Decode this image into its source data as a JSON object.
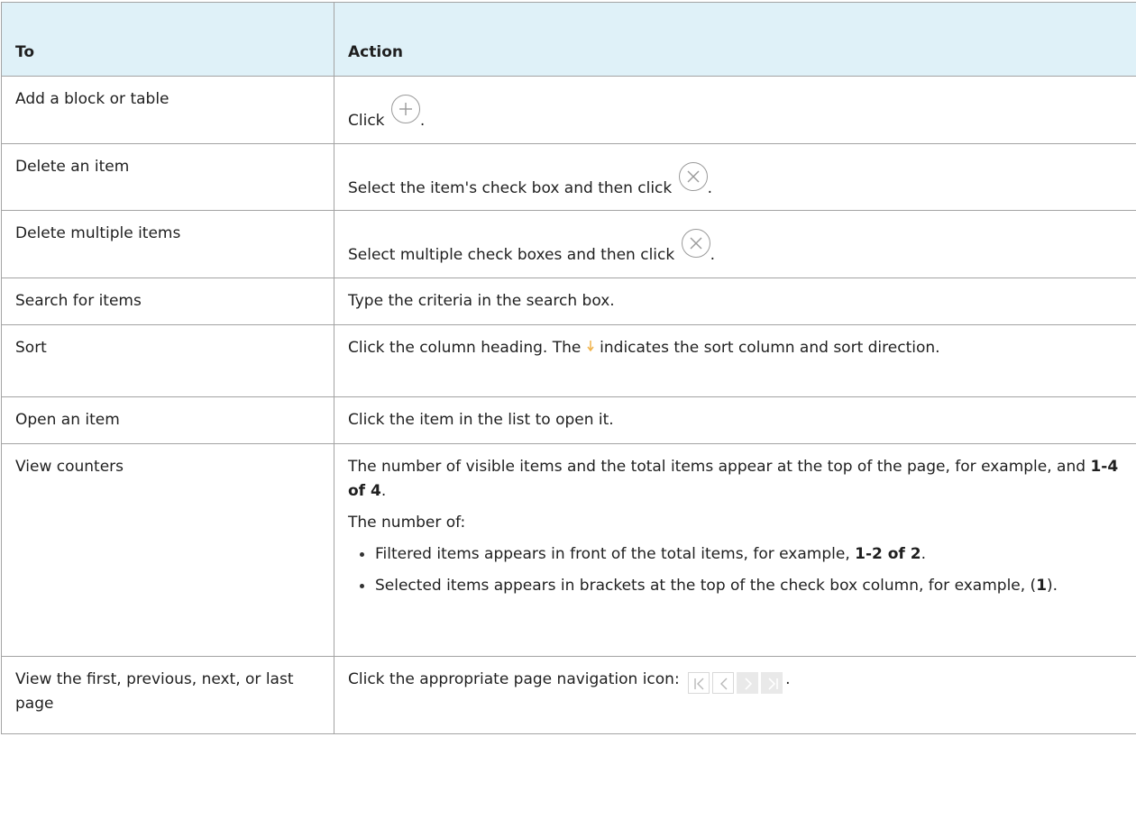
{
  "header": {
    "col_to": "To",
    "col_action": "Action"
  },
  "rows": [
    {
      "to": "Add a block or table",
      "action_pre": "Click",
      "action_post": "."
    },
    {
      "to": "Delete an item",
      "action_pre": "Select the item's check box and then click",
      "action_post": "."
    },
    {
      "to": "Delete multiple items",
      "action_pre": "Select multiple check boxes and then click",
      "action_post": "."
    },
    {
      "to": "Search for items",
      "action": "Type the criteria in the search box."
    },
    {
      "to": "Sort",
      "action_pre": "Click the column heading. The",
      "action_post": "indicates the sort column and sort direction."
    },
    {
      "to": "Open an item",
      "action": "Click the item in the list to open it."
    },
    {
      "to": "View counters",
      "p1_pre": "The number of visible items and the total items appear at the top of the page, for example, and",
      "p1_bold": "1-4 of 4",
      "p1_post": ".",
      "p2": "The number of:",
      "bullet1_pre": "Filtered items appears in front of the total items, for example,",
      "bullet1_bold": "1-2 of 2",
      "bullet1_post": ".",
      "bullet2_pre": "Selected items appears in brackets at the top of the check box column, for example, (",
      "bullet2_bold": "1",
      "bullet2_post": ")."
    },
    {
      "to": "View the first, previous, next, or last page",
      "action_pre": "Click the appropriate page navigation icon:",
      "action_post": "."
    }
  ],
  "icons": {
    "add": "plus-circle-icon",
    "delete": "x-circle-icon",
    "sort": "arrow-down-icon",
    "nav": [
      "first-page-icon",
      "previous-page-icon",
      "next-page-icon",
      "last-page-icon"
    ]
  },
  "colors": {
    "header_bg": "#dff1f8",
    "border": "#a3a3a3",
    "sort_arrow": "#f0b24a",
    "icon_gray": "#9a9a9a"
  }
}
